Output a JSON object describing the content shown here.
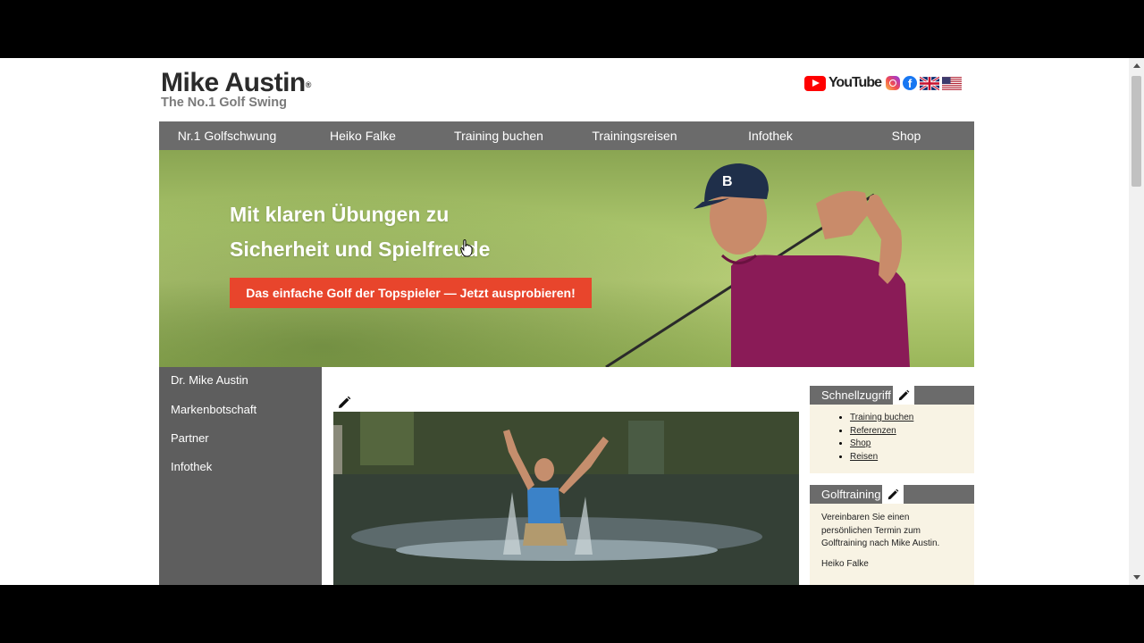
{
  "header": {
    "logo_name": "Mike Austin",
    "logo_registered": "®",
    "logo_tagline": "The No.1 Golf Swing",
    "youtube_label": "YouTube",
    "facebook_letter": "f"
  },
  "nav": {
    "items": [
      "Nr.1 Golfschwung",
      "Heiko Falke",
      "Training buchen",
      "Trainingsreisen",
      "Infothek",
      "Shop"
    ]
  },
  "hero": {
    "headline_line1": "Mit klaren Übungen zu",
    "headline_line2": "Sicherheit und Spielfreude",
    "cta_label": "Das einfache Golf der Topspieler — Jetzt ausprobieren!"
  },
  "left_sidebar": {
    "items": [
      "Dr. Mike Austin",
      "Markenbotschaft",
      "Partner",
      "Infothek"
    ]
  },
  "quick_access": {
    "title": "Schnellzugriff",
    "links": [
      "Training buchen",
      "Referenzen",
      "Shop",
      "Reisen"
    ]
  },
  "golf_training": {
    "title": "Golftraining",
    "text": "Vereinbaren Sie einen persönlichen Termin zum Golftraining nach Mike Austin.",
    "signature": "Heiko Falke"
  },
  "colors": {
    "nav_bg": "#6b6b6b",
    "cta_bg": "#e8452c",
    "box_bg": "#f8f3e4"
  }
}
